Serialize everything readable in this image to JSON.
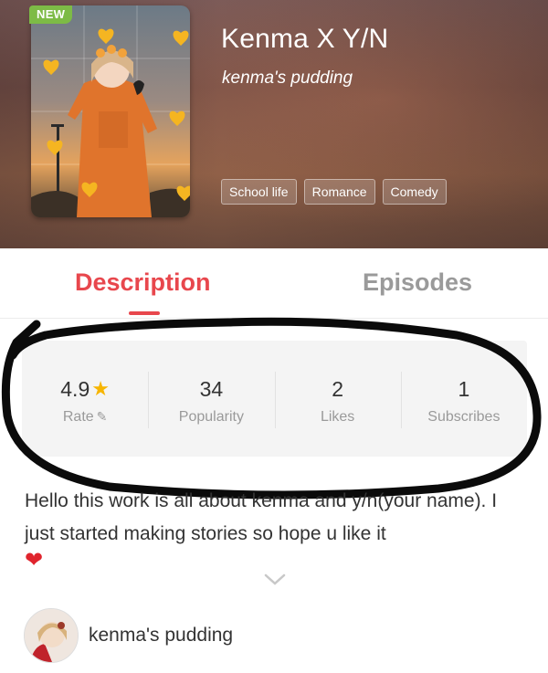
{
  "badge": {
    "new": "NEW"
  },
  "story": {
    "title": "Kenma X Y/N",
    "author": "kenma's pudding",
    "tags": [
      "School life",
      "Romance",
      "Comedy"
    ]
  },
  "tabs": {
    "description": "Description",
    "episodes": "Episodes",
    "active": "Description"
  },
  "stats": {
    "rate": {
      "value": "4.9",
      "label": "Rate"
    },
    "popularity": {
      "value": "34",
      "label": "Popularity"
    },
    "likes": {
      "value": "2",
      "label": "Likes"
    },
    "subscribes": {
      "value": "1",
      "label": "Subscribes"
    }
  },
  "description": {
    "text": "Hello this work is all about kenma and y/n(your name). I just started making stories so hope u like it"
  },
  "author_row": {
    "name": "kenma's pudding"
  },
  "icons": {
    "star": "star-icon",
    "pencil": "pencil-icon",
    "heart": "heart-icon",
    "chevron": "chevron-down-icon"
  },
  "colors": {
    "accent": "#e8474d",
    "badge_green": "#7dbb46",
    "star_yellow": "#f7b500",
    "heart_red": "#e0242d"
  }
}
